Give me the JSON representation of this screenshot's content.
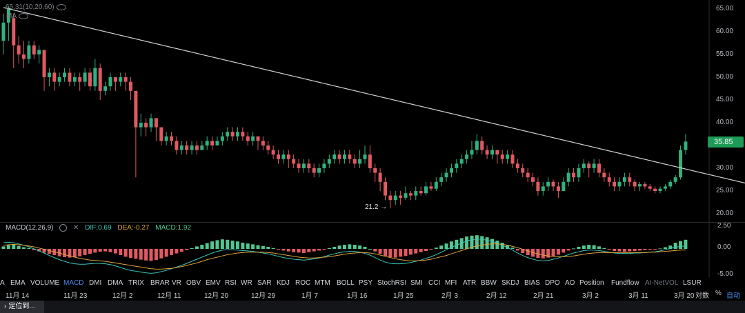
{
  "colors": {
    "up": "#2fb27f",
    "down": "#e05a61",
    "trendline": "#d0d0d0",
    "dif": "#3cc6b5",
    "dea": "#e0a33b",
    "macd_up": "#52c791",
    "macd_down": "#e05a61"
  },
  "header": {
    "ma_params": "(10,20,60)",
    "ma_label": "MA",
    "icon": "eye-icon"
  },
  "price_axis": {
    "ticks": [
      "65.00",
      "60.00",
      "55.00",
      "50.00",
      "45.00",
      "40.00",
      "35.00",
      "30.00",
      "25.00",
      "20.00"
    ],
    "current_price": "35.85"
  },
  "annotations": {
    "high": "65.31",
    "low": "21.2 →"
  },
  "macd": {
    "name": "MACD(12,26,9)",
    "dif": "DIF:0.69",
    "dea": "DEA:-0.27",
    "macd": "MACD:1.92",
    "ticks": [
      "2.50",
      "0.00",
      "-5.00"
    ]
  },
  "indicator_tabs": [
    "A",
    "EMA",
    "VOLUME",
    "MACD",
    "DMI",
    "DMA",
    "TRIX",
    "BRAR",
    "VR",
    "OBV",
    "EMV",
    "RSI",
    "WR",
    "SAR",
    "KDJ",
    "ROC",
    "MTM",
    "BOLL",
    "PSY",
    "StochRSI",
    "SMI",
    "CCI",
    "MFI",
    "ATR",
    "BBW",
    "SKDJ",
    "BIAS",
    "DPO",
    "AO",
    "Position",
    "Fundflow",
    "AI-NetVOL",
    "LSUR"
  ],
  "active_indicator": "MACD",
  "dates": [
    "11月 14",
    "11月 23",
    "12月 2",
    "12月 11",
    "12月 20",
    "12月 29",
    "1月 7",
    "1月 16",
    "1月 25",
    "2月 3",
    "2月 12",
    "2月 21",
    "3月 2",
    "3月 11",
    "3月 20"
  ],
  "right_controls": {
    "log": "对数",
    "percent": "%",
    "auto": "自动"
  },
  "bottom": {
    "locate": "定位到..."
  },
  "chart_data": {
    "type": "candlestick",
    "y_range": [
      18,
      67
    ],
    "trendline": [
      [
        0,
        65.3
      ],
      [
        153,
        24.8
      ]
    ],
    "candles": [
      [
        0,
        58,
        62,
        64,
        55
      ],
      [
        1,
        62,
        65.3,
        65.5,
        58
      ],
      [
        2,
        63,
        57,
        64,
        52
      ],
      [
        3,
        57,
        55,
        59,
        53
      ],
      [
        4,
        55,
        54,
        58,
        52
      ],
      [
        5,
        54,
        57,
        58,
        53
      ],
      [
        6,
        57,
        55,
        58,
        54
      ],
      [
        7,
        55,
        56,
        57,
        53
      ],
      [
        8,
        56,
        50,
        56,
        47
      ],
      [
        9,
        50,
        51,
        52,
        48
      ],
      [
        10,
        51,
        49,
        52,
        47
      ],
      [
        11,
        49,
        50,
        51,
        48
      ],
      [
        12,
        50,
        51,
        52,
        49
      ],
      [
        13,
        51,
        49,
        52,
        48
      ],
      [
        14,
        49,
        50,
        51,
        48
      ],
      [
        15,
        50,
        49,
        51,
        47
      ],
      [
        16,
        49,
        51,
        52,
        48
      ],
      [
        17,
        51,
        48,
        52,
        47
      ],
      [
        18,
        48,
        52,
        54,
        47
      ],
      [
        19,
        52,
        47,
        53,
        45
      ],
      [
        20,
        47,
        48,
        49,
        46
      ],
      [
        21,
        48,
        50,
        51,
        47
      ],
      [
        22,
        50,
        49,
        50,
        47
      ],
      [
        23,
        49,
        50,
        51,
        48
      ],
      [
        24,
        50,
        49,
        51,
        47
      ],
      [
        25,
        49,
        47,
        50,
        45
      ],
      [
        26,
        47,
        39,
        47,
        28
      ],
      [
        27,
        39,
        40,
        42,
        37
      ],
      [
        28,
        40,
        39,
        41,
        37
      ],
      [
        29,
        39,
        41,
        42,
        38
      ],
      [
        30,
        41,
        39,
        41,
        36
      ],
      [
        31,
        39,
        36,
        39,
        35
      ],
      [
        32,
        36,
        37,
        38,
        35
      ],
      [
        33,
        37,
        36,
        38,
        35
      ],
      [
        34,
        36,
        34,
        37,
        33
      ],
      [
        35,
        34,
        35,
        36,
        33
      ],
      [
        36,
        35,
        34,
        36,
        33
      ],
      [
        37,
        34,
        35,
        36,
        33
      ],
      [
        38,
        35,
        34,
        36,
        33
      ],
      [
        39,
        34,
        35,
        36,
        34
      ],
      [
        40,
        35,
        36,
        37,
        34
      ],
      [
        41,
        36,
        35,
        37,
        34
      ],
      [
        42,
        35,
        36,
        37,
        35
      ],
      [
        43,
        36,
        37,
        38,
        35
      ],
      [
        44,
        37,
        38,
        39,
        36
      ],
      [
        45,
        38,
        37,
        39,
        36
      ],
      [
        46,
        37,
        38,
        39,
        36
      ],
      [
        47,
        38,
        37,
        39,
        36
      ],
      [
        48,
        37,
        36,
        38,
        35
      ],
      [
        49,
        36,
        37,
        38,
        35
      ],
      [
        50,
        37,
        36,
        37,
        34
      ],
      [
        51,
        36,
        35,
        37,
        34
      ],
      [
        52,
        35,
        34,
        36,
        33
      ],
      [
        53,
        34,
        33,
        35,
        32
      ],
      [
        54,
        33,
        32,
        34,
        31
      ],
      [
        55,
        32,
        33,
        34,
        31
      ],
      [
        56,
        33,
        32,
        34,
        30
      ],
      [
        57,
        32,
        31,
        33,
        30
      ],
      [
        58,
        31,
        30,
        32,
        29
      ],
      [
        59,
        30,
        31,
        32,
        29
      ],
      [
        60,
        31,
        30,
        32,
        29
      ],
      [
        61,
        30,
        29,
        31,
        28
      ],
      [
        62,
        29,
        30,
        31,
        28
      ],
      [
        63,
        30,
        31,
        32,
        29
      ],
      [
        64,
        31,
        32,
        33,
        30
      ],
      [
        65,
        32,
        33,
        34,
        31
      ],
      [
        66,
        33,
        32,
        34,
        31
      ],
      [
        67,
        32,
        33,
        34,
        31
      ],
      [
        68,
        33,
        32,
        34,
        31
      ],
      [
        69,
        32,
        31,
        33,
        30
      ],
      [
        70,
        31,
        32,
        34,
        30
      ],
      [
        71,
        32,
        33,
        35,
        31
      ],
      [
        72,
        33,
        30,
        35,
        29
      ],
      [
        73,
        30,
        29,
        31,
        27
      ],
      [
        74,
        29,
        27,
        30,
        25
      ],
      [
        75,
        27,
        24,
        28,
        23
      ],
      [
        76,
        24,
        23,
        25,
        21.2
      ],
      [
        77,
        23,
        24,
        25,
        22
      ],
      [
        78,
        24,
        23.5,
        25,
        22
      ],
      [
        79,
        23.5,
        24.5,
        26,
        23
      ],
      [
        80,
        24.5,
        24,
        25,
        23
      ],
      [
        81,
        24,
        25,
        26,
        23
      ],
      [
        82,
        25,
        24.5,
        26,
        24
      ],
      [
        83,
        24.5,
        26,
        27,
        24
      ],
      [
        84,
        26,
        25.5,
        27,
        25
      ],
      [
        85,
        25.5,
        27,
        28,
        25
      ],
      [
        86,
        27,
        28,
        29,
        26
      ],
      [
        87,
        28,
        29,
        30,
        27
      ],
      [
        88,
        29,
        30,
        31,
        28
      ],
      [
        89,
        30,
        31,
        32,
        29
      ],
      [
        90,
        31,
        32,
        33,
        30
      ],
      [
        91,
        32,
        33,
        34,
        31
      ],
      [
        92,
        33,
        34,
        36,
        32
      ],
      [
        93,
        34,
        36,
        37.5,
        33
      ],
      [
        94,
        36,
        34,
        37,
        33
      ],
      [
        95,
        34,
        33,
        35,
        32
      ],
      [
        96,
        33,
        34,
        35,
        32
      ],
      [
        97,
        34,
        33,
        34,
        31
      ],
      [
        98,
        33,
        32,
        34,
        31
      ],
      [
        99,
        32,
        33,
        34,
        31
      ],
      [
        100,
        33,
        31,
        34,
        30
      ],
      [
        101,
        31,
        30,
        32,
        29
      ],
      [
        102,
        30,
        29,
        31,
        28
      ],
      [
        103,
        29,
        28,
        30,
        27
      ],
      [
        104,
        28,
        27,
        29,
        26
      ],
      [
        105,
        27,
        25,
        28,
        24
      ],
      [
        106,
        25,
        26,
        27,
        24
      ],
      [
        107,
        26,
        27,
        28,
        25
      ],
      [
        108,
        27,
        26,
        27.5,
        25
      ],
      [
        109,
        26,
        25,
        27,
        23.5
      ],
      [
        110,
        25,
        27,
        28,
        25
      ],
      [
        111,
        27,
        29,
        30,
        26
      ],
      [
        112,
        29,
        28,
        30,
        27
      ],
      [
        113,
        28,
        30,
        31,
        27
      ],
      [
        114,
        30,
        31,
        32,
        29
      ],
      [
        115,
        31,
        30,
        31.5,
        28
      ],
      [
        116,
        30,
        31,
        32,
        29
      ],
      [
        117,
        31,
        29,
        32,
        28
      ],
      [
        118,
        29,
        28,
        30,
        27
      ],
      [
        119,
        28,
        27,
        29,
        26
      ],
      [
        120,
        27,
        26,
        28,
        25
      ],
      [
        121,
        26,
        27,
        28,
        25
      ],
      [
        122,
        27,
        28,
        29,
        26
      ],
      [
        123,
        28,
        27,
        29,
        26
      ],
      [
        124,
        27,
        26,
        27.5,
        25
      ],
      [
        125,
        26,
        26.5,
        27,
        25
      ],
      [
        126,
        26.5,
        26,
        27,
        25.5
      ],
      [
        127,
        26,
        25.5,
        26.5,
        25
      ],
      [
        128,
        25.5,
        25,
        26,
        24.5
      ],
      [
        129,
        25,
        25.5,
        26,
        24.5
      ],
      [
        130,
        25.5,
        26,
        26.5,
        25
      ],
      [
        131,
        26,
        27,
        27.5,
        25.5
      ],
      [
        132,
        27,
        28,
        28.5,
        26.5
      ],
      [
        133,
        28,
        34,
        35,
        27.5
      ],
      [
        134,
        34,
        35.85,
        37.5,
        33
      ]
    ],
    "macd_hist": [
      0.6,
      0.9,
      1.1,
      0.7,
      0.4,
      0.2,
      -0.3,
      -0.6,
      -0.9,
      -1.2,
      -1.5,
      -1.8,
      -2.0,
      -2.1,
      -2.0,
      -1.8,
      -1.5,
      -1.2,
      -0.9,
      -0.7,
      -0.6,
      -0.8,
      -1.1,
      -1.5,
      -1.9,
      -2.2,
      -2.4,
      -2.6,
      -2.8,
      -2.9,
      -2.7,
      -2.3,
      -1.9,
      -1.5,
      -1.1,
      -0.7,
      -0.3,
      0.2,
      0.6,
      1.0,
      1.4,
      1.8,
      2.1,
      2.3,
      2.2,
      2.0,
      1.8,
      1.5,
      1.3,
      1.1,
      0.9,
      0.7,
      0.5,
      0.2,
      -0.1,
      -0.4,
      -0.6,
      -0.8,
      -0.9,
      -1.0,
      -0.8,
      -0.6,
      -0.4,
      -0.2,
      0.2,
      0.5,
      0.8,
      1.0,
      1.1,
      1.0,
      0.8,
      0.5,
      0.0,
      -0.6,
      -1.2,
      -1.7,
      -2.0,
      -2.1,
      -1.9,
      -1.7,
      -1.4,
      -1.1,
      -0.8,
      -0.5,
      -0.2,
      0.3,
      0.8,
      1.3,
      1.8,
      2.2,
      2.6,
      3.0,
      3.2,
      3.3,
      3.1,
      2.8,
      2.4,
      2.0,
      1.5,
      0.9,
      0.3,
      -0.4,
      -1.0,
      -1.5,
      -1.9,
      -2.2,
      -2.3,
      -2.1,
      -1.8,
      -1.4,
      -0.9,
      -0.4,
      0.1,
      0.5,
      0.8,
      1.0,
      0.9,
      0.6,
      0.2,
      -0.2,
      -0.5,
      -0.6,
      -0.7,
      -0.6,
      -0.5,
      -0.4,
      -0.3,
      -0.2,
      -0.1,
      0.1,
      0.4,
      0.8,
      1.5,
      1.9,
      2.2
    ],
    "dif": [
      1.5,
      1.6,
      1.5,
      1.2,
      0.9,
      0.5,
      0.0,
      -0.5,
      -1.0,
      -1.6,
      -2.1,
      -2.6,
      -3.0,
      -3.4,
      -3.6,
      -3.7,
      -3.7,
      -3.6,
      -3.5,
      -3.5,
      -3.6,
      -3.8,
      -4.1,
      -4.5,
      -4.9,
      -5.2,
      -5.4,
      -5.6,
      -5.8,
      -5.9,
      -5.8,
      -5.5,
      -5.2,
      -4.8,
      -4.4,
      -4.0,
      -3.5,
      -3.0,
      -2.5,
      -2.0,
      -1.5,
      -1.0,
      -0.6,
      -0.3,
      -0.2,
      -0.2,
      -0.3,
      -0.4,
      -0.5,
      -0.6,
      -0.8,
      -1.0,
      -1.2,
      -1.5,
      -1.8,
      -2.1,
      -2.3,
      -2.5,
      -2.6,
      -2.7,
      -2.6,
      -2.4,
      -2.2,
      -1.9,
      -1.5,
      -1.2,
      -0.9,
      -0.7,
      -0.6,
      -0.6,
      -0.8,
      -1.1,
      -1.5,
      -2.1,
      -2.7,
      -3.2,
      -3.5,
      -3.6,
      -3.6,
      -3.5,
      -3.3,
      -3.0,
      -2.7,
      -2.3,
      -1.9,
      -1.4,
      -0.8,
      -0.2,
      0.4,
      0.9,
      1.4,
      1.9,
      2.2,
      2.4,
      2.3,
      2.1,
      1.8,
      1.4,
      0.9,
      0.3,
      -0.3,
      -1.0,
      -1.6,
      -2.1,
      -2.5,
      -2.8,
      -2.9,
      -2.8,
      -2.5,
      -2.2,
      -1.8,
      -1.4,
      -1.0,
      -0.7,
      -0.4,
      -0.3,
      -0.3,
      -0.4,
      -0.6,
      -0.8,
      -1.0,
      -1.1,
      -1.1,
      -1.1,
      -1.0,
      -1.0,
      -0.9,
      -0.8,
      -0.7,
      -0.5,
      -0.2,
      0.1,
      0.4,
      0.6,
      0.69
    ],
    "dea": [
      0.9,
      1.0,
      1.1,
      1.0,
      0.9,
      0.7,
      0.5,
      0.2,
      -0.1,
      -0.4,
      -0.7,
      -1.0,
      -1.4,
      -1.7,
      -2.0,
      -2.3,
      -2.5,
      -2.7,
      -2.8,
      -2.9,
      -3.0,
      -3.2,
      -3.4,
      -3.6,
      -3.8,
      -4.0,
      -4.2,
      -4.4,
      -4.6,
      -4.8,
      -4.9,
      -4.9,
      -4.8,
      -4.7,
      -4.5,
      -4.3,
      -4.0,
      -3.7,
      -3.4,
      -3.0,
      -2.6,
      -2.3,
      -2.0,
      -1.7,
      -1.4,
      -1.2,
      -1.0,
      -0.9,
      -0.8,
      -0.8,
      -0.8,
      -0.8,
      -0.9,
      -1.0,
      -1.2,
      -1.4,
      -1.6,
      -1.8,
      -2.0,
      -2.1,
      -2.2,
      -2.2,
      -2.1,
      -2.0,
      -1.9,
      -1.7,
      -1.5,
      -1.3,
      -1.1,
      -1.0,
      -0.9,
      -0.9,
      -1.0,
      -1.2,
      -1.5,
      -1.8,
      -2.1,
      -2.4,
      -2.6,
      -2.8,
      -2.9,
      -2.9,
      -2.8,
      -2.7,
      -2.5,
      -2.2,
      -1.9,
      -1.6,
      -1.2,
      -0.8,
      -0.4,
      0.0,
      0.4,
      0.7,
      0.9,
      1.1,
      1.2,
      1.2,
      1.1,
      0.9,
      0.6,
      0.3,
      -0.1,
      -0.5,
      -0.9,
      -1.2,
      -1.5,
      -1.7,
      -1.8,
      -1.9,
      -1.9,
      -1.8,
      -1.7,
      -1.5,
      -1.3,
      -1.1,
      -1.0,
      -0.9,
      -0.9,
      -0.9,
      -0.9,
      -0.9,
      -0.9,
      -0.9,
      -0.9,
      -0.9,
      -0.9,
      -0.8,
      -0.8,
      -0.7,
      -0.6,
      -0.5,
      -0.4,
      -0.3,
      -0.27
    ]
  }
}
